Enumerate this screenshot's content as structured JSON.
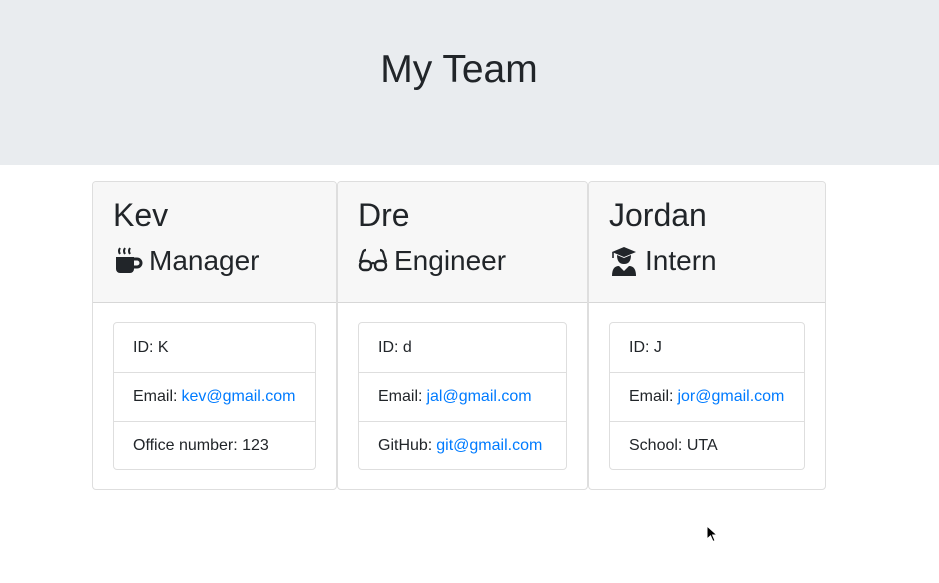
{
  "header": {
    "title": "My Team",
    "background": "#e9ecef"
  },
  "employees": [
    {
      "name": "Kev",
      "role": "Manager",
      "role_icon": "mug-icon",
      "id_label": "ID: K",
      "email_label": "Email:",
      "email": "kev@gmail.com",
      "extra_label": "Office number: 123",
      "extra_link": ""
    },
    {
      "name": "Dre",
      "role": "Engineer",
      "role_icon": "glasses-icon",
      "id_label": "ID: d",
      "email_label": "Email:",
      "email": "jal@gmail.com",
      "extra_label": "GitHub:",
      "extra_link": "git@gmail.com"
    },
    {
      "name": "Jordan",
      "role": "Intern",
      "role_icon": "graduate-icon",
      "id_label": "ID: J",
      "email_label": "Email:",
      "email": "jor@gmail.com",
      "extra_label": "School: UTA",
      "extra_link": ""
    }
  ],
  "colors": {
    "link": "#007bff",
    "text": "#212529",
    "card_header": "#f7f7f7"
  }
}
